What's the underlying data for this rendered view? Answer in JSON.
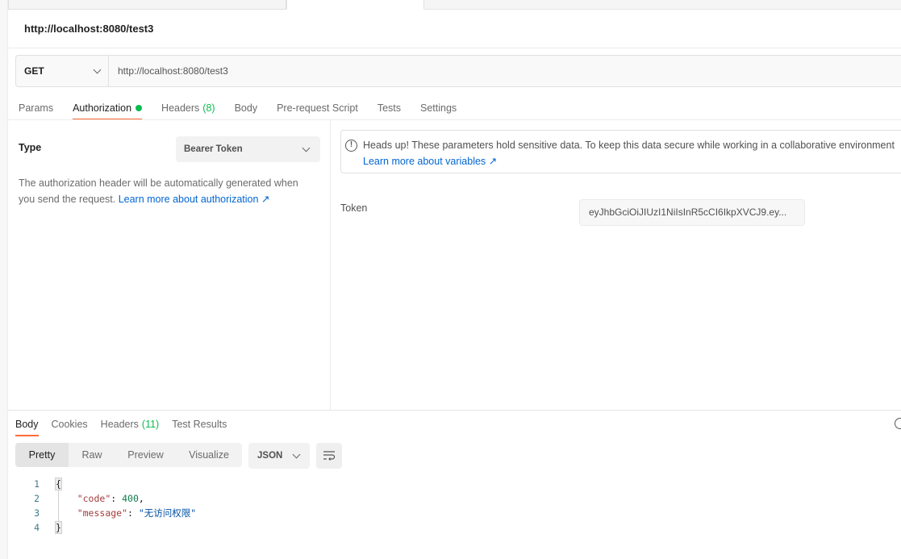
{
  "request": {
    "title": "http://localhost:8080/test3",
    "method": "GET",
    "url": "http://localhost:8080/test3"
  },
  "request_tabs": {
    "params": "Params",
    "authorization": "Authorization",
    "headers": "Headers",
    "headers_count": "(8)",
    "body": "Body",
    "pre_request": "Pre-request Script",
    "tests": "Tests",
    "settings": "Settings"
  },
  "auth": {
    "type_label": "Type",
    "type_value": "Bearer Token",
    "description": "The authorization header will be automatically generated when you send the request. ",
    "description_link": "Learn more about authorization ↗",
    "notice_text": "Heads up! These parameters hold sensitive data. To keep this data secure while working in a collaborative environment",
    "notice_link": "Learn more about variables ↗",
    "token_label": "Token",
    "token_value": "eyJhbGciOiJIUzI1NiIsInR5cCI6IkpXVCJ9.ey..."
  },
  "response_tabs": {
    "body": "Body",
    "cookies": "Cookies",
    "headers": "Headers",
    "headers_count": "(11)",
    "test_results": "Test Results"
  },
  "response_view": {
    "pretty": "Pretty",
    "raw": "Raw",
    "preview": "Preview",
    "visualize": "Visualize",
    "format": "JSON"
  },
  "response_body": {
    "line_numbers": [
      "1",
      "2",
      "3",
      "4"
    ],
    "open_brace": "{",
    "code_key": "\"code\"",
    "code_value": "400",
    "message_key": "\"message\"",
    "message_value": "\"无访问权限\"",
    "close_brace": "}"
  },
  "colors": {
    "accent": "#ff6c37",
    "success": "#0cbb52",
    "link": "#0265d2"
  },
  "icons": [
    "chevron-down-icon",
    "info-icon",
    "globe-icon",
    "wrap-lines-icon"
  ]
}
